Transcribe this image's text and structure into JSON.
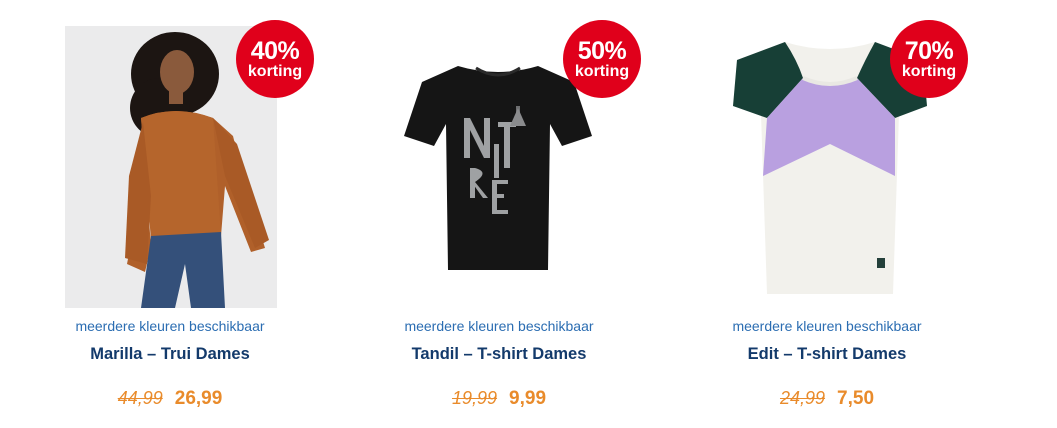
{
  "products": [
    {
      "badge_percent": "40%",
      "badge_word": "korting",
      "colors_note": "meerdere kleuren beschikbaar",
      "title": "Marilla – Trui Dames",
      "old_price": "44,99",
      "new_price": "26,99"
    },
    {
      "badge_percent": "50%",
      "badge_word": "korting",
      "colors_note": "meerdere kleuren beschikbaar",
      "title": "Tandil – T-shirt Dames",
      "old_price": "19,99",
      "new_price": "9,99"
    },
    {
      "badge_percent": "70%",
      "badge_word": "korting",
      "colors_note": "meerdere kleuren beschikbaar",
      "title": "Edit – T-shirt Dames",
      "old_price": "24,99",
      "new_price": "7,50"
    }
  ],
  "colors": {
    "badge": "#e0001b",
    "price": "#e98b2b",
    "title": "#133a6b",
    "link": "#2b6db2"
  }
}
